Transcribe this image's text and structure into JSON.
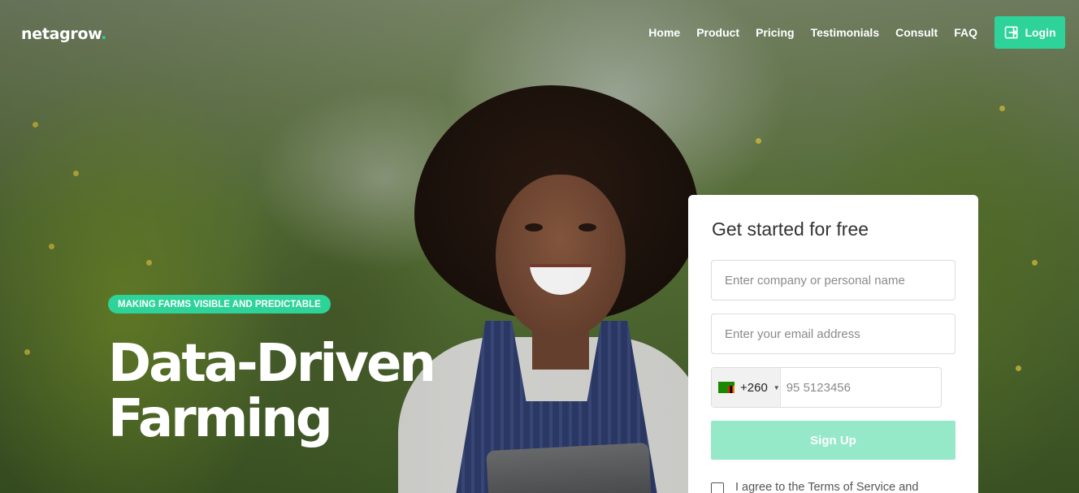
{
  "brand": {
    "name": "netagrow",
    "dot": ".",
    "accent": "#2ed39a"
  },
  "nav": {
    "links": [
      "Home",
      "Product",
      "Pricing",
      "Testimonials",
      "Consult",
      "FAQ"
    ],
    "login_label": "Login",
    "login_icon": "login-icon"
  },
  "hero": {
    "badge": "MAKING FARMS VISIBLE AND PREDICTABLE",
    "headline_line1": "Data-Driven",
    "headline_line2": "Farming"
  },
  "form": {
    "title": "Get started for free",
    "name_placeholder": "Enter company or personal name",
    "email_placeholder": "Enter your email address",
    "country_code": "+260",
    "phone_placeholder": "95 5123456",
    "signup_label": "Sign Up",
    "terms_text": "I agree to the Terms of Service and"
  }
}
